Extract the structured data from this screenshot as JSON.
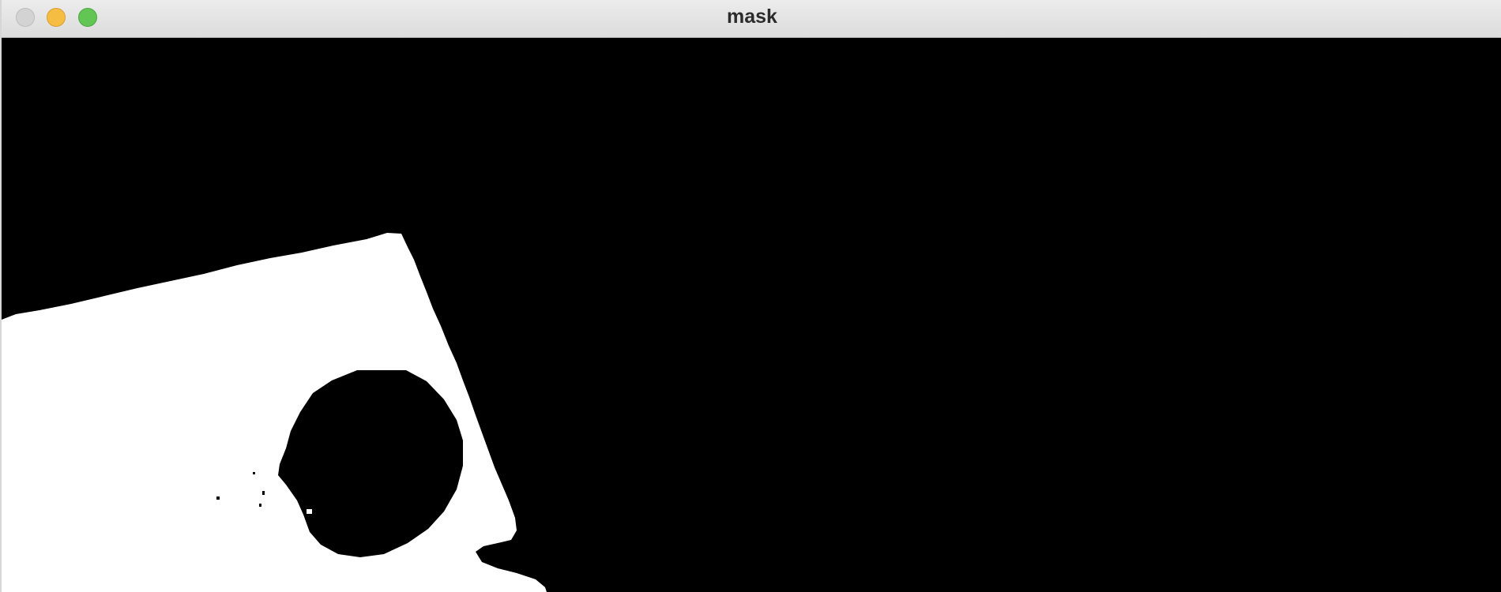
{
  "window": {
    "title": "mask",
    "buttons": {
      "close_color": "#d3d3d3",
      "minimize_color": "#f6bd43",
      "zoom_color": "#62c554"
    }
  },
  "image": {
    "mask_color": "#ffffff",
    "background_color": "#000000"
  }
}
